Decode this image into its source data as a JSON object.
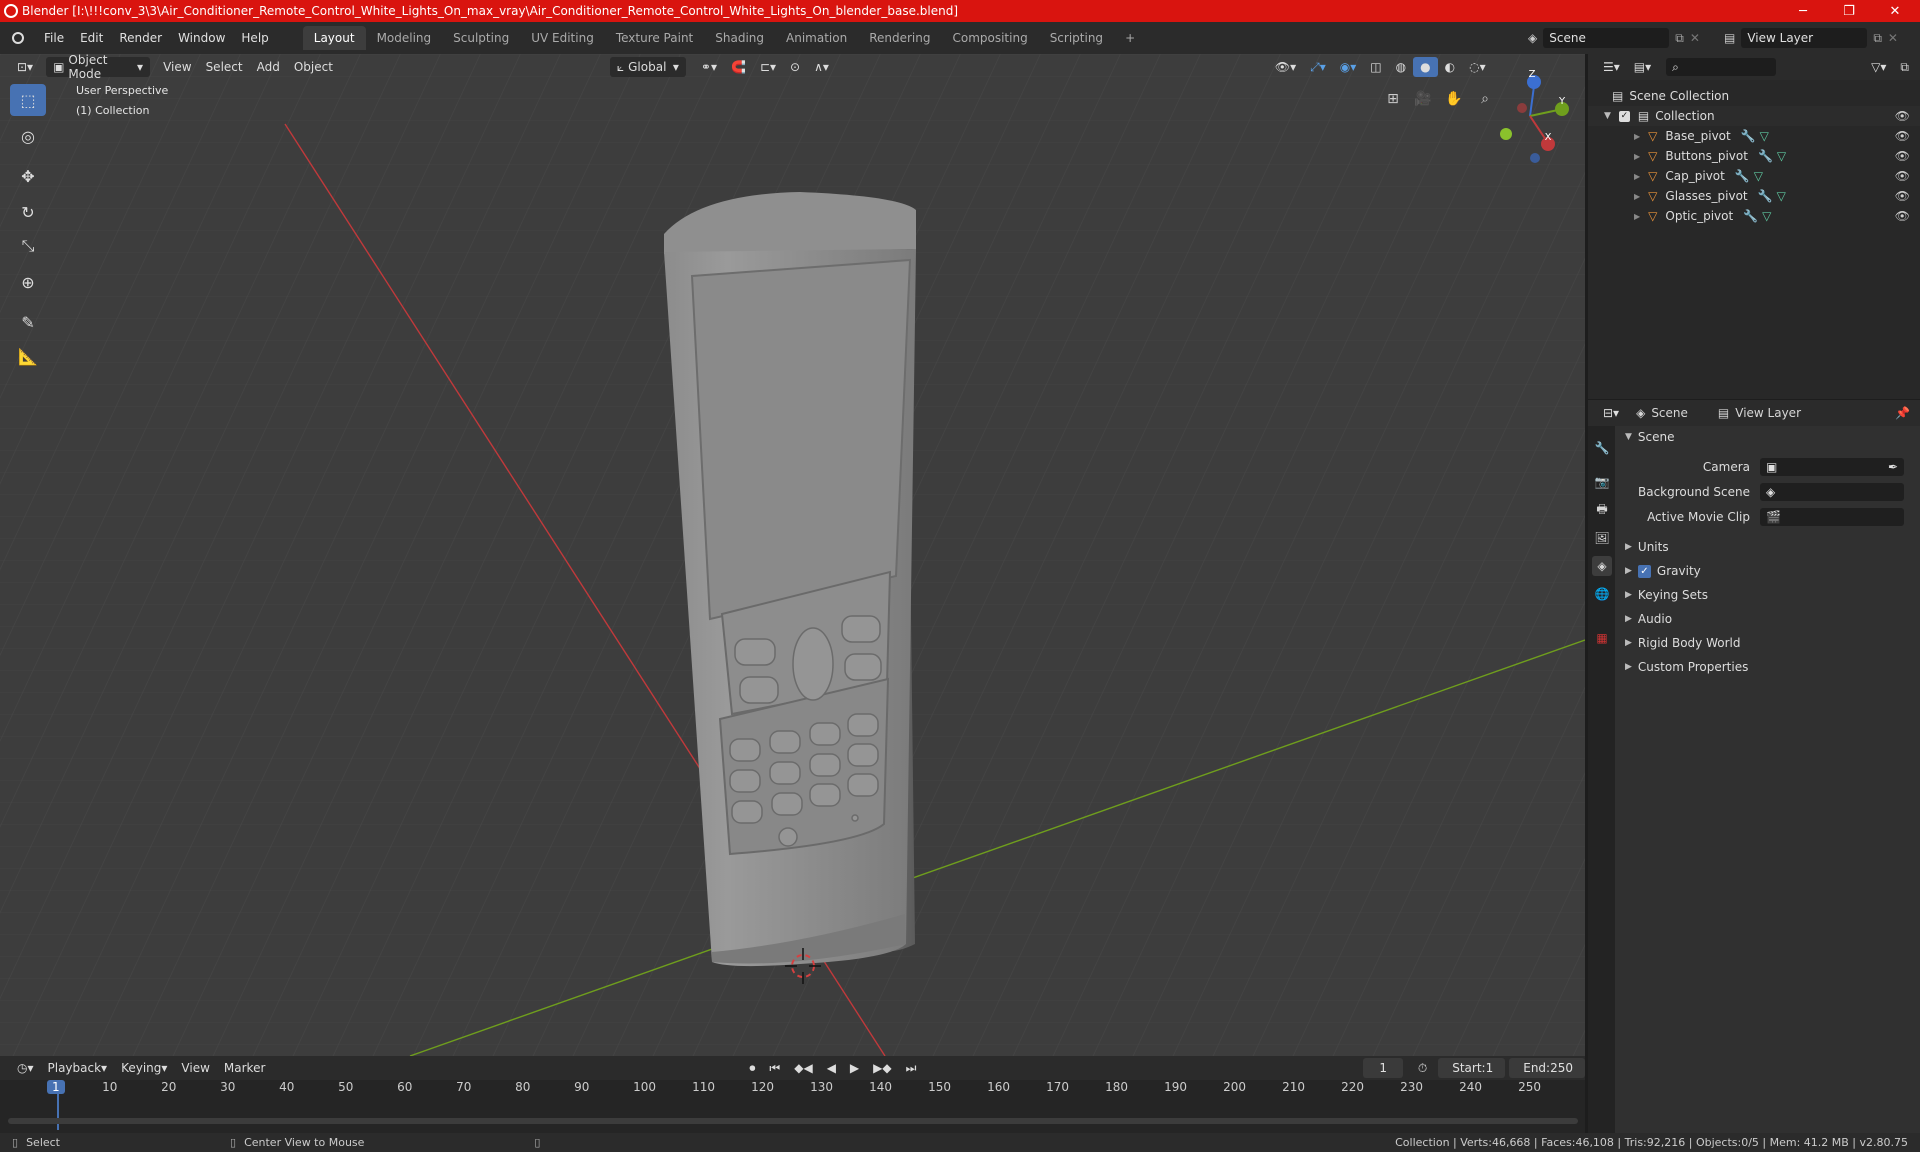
{
  "window": {
    "title": "Blender [I:\\!!!conv_3\\3\\Air_Conditioner_Remote_Control_White_Lights_On_max_vray\\Air_Conditioner_Remote_Control_White_Lights_On_blender_base.blend]",
    "minimize": "─",
    "maximize": "❐",
    "close": "✕"
  },
  "menu": [
    "File",
    "Edit",
    "Render",
    "Window",
    "Help"
  ],
  "workspaces": [
    "Layout",
    "Modeling",
    "Sculpting",
    "UV Editing",
    "Texture Paint",
    "Shading",
    "Animation",
    "Rendering",
    "Compositing",
    "Scripting"
  ],
  "active_workspace": "Layout",
  "add_workspace": "+",
  "scene_field": "Scene",
  "view_layer_field": "View Layer",
  "viewport": {
    "mode": "Object Mode",
    "menus": [
      "View",
      "Select",
      "Add",
      "Object"
    ],
    "orientation": "Global",
    "overlay_title": "User Perspective",
    "overlay_sub": "(1) Collection",
    "gizmo": {
      "z": "Z",
      "y": "Y",
      "x": "X"
    }
  },
  "outliner": {
    "root": "Scene Collection",
    "collection": "Collection",
    "objects": [
      "Base_pivot",
      "Buttons_pivot",
      "Cap_pivot",
      "Glasses_pivot",
      "Optic_pivot"
    ]
  },
  "properties": {
    "tab_scene": "Scene",
    "tab_view_layer": "View Layer",
    "section": "Scene",
    "camera_label": "Camera",
    "background_scene_label": "Background Scene",
    "active_movie_clip_label": "Active Movie Clip",
    "panels": [
      "Units",
      "Gravity",
      "Keying Sets",
      "Audio",
      "Rigid Body World",
      "Custom Properties"
    ],
    "gravity_checked": true
  },
  "timeline": {
    "menus": [
      "Playback",
      "Keying",
      "View",
      "Marker"
    ],
    "current_frame": "1",
    "start_label": "Start:",
    "start": "1",
    "end_label": "End:",
    "end": "250",
    "ticks": [
      "1",
      "10",
      "20",
      "30",
      "40",
      "50",
      "60",
      "70",
      "80",
      "90",
      "100",
      "110",
      "120",
      "130",
      "140",
      "150",
      "160",
      "170",
      "180",
      "190",
      "200",
      "210",
      "220",
      "230",
      "240",
      "250"
    ]
  },
  "status": {
    "left": "Select",
    "middle": "Center View to Mouse",
    "right": "Collection | Verts:46,668 | Faces:46,108 | Tris:92,216 | Objects:0/5 | Mem: 41.2 MB | v2.80.75"
  },
  "colors": {
    "title_bar": "#d9140f",
    "accent": "#4772b3",
    "x_axis": "#c0393b",
    "y_axis": "#6f9e1d",
    "object_orange": "#e8923a"
  }
}
